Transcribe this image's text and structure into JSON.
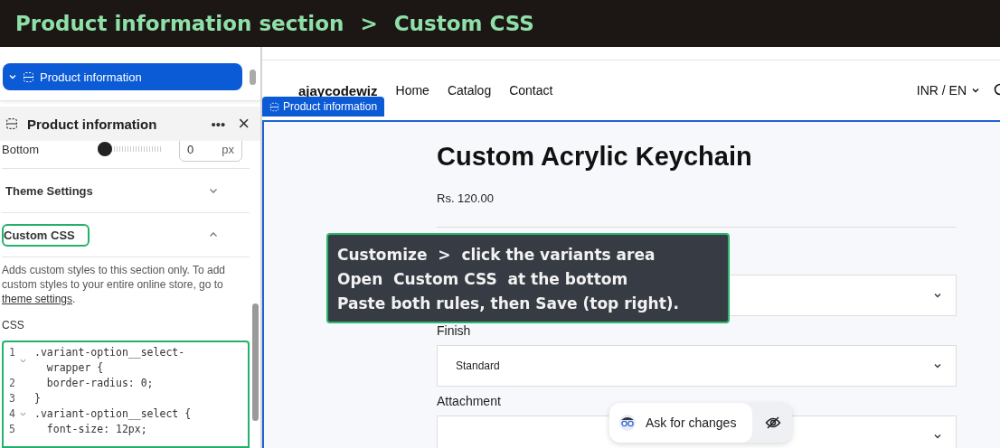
{
  "banner": {
    "title": "Product information section",
    "separator": ">",
    "subtitle": "Custom CSS"
  },
  "sidebar": {
    "tree_item": {
      "label": "Product information",
      "selected": true,
      "expanded": true
    },
    "panel": {
      "title": "Product information",
      "more": "•••",
      "close": "×"
    },
    "bottom_setting": {
      "label": "Bottom",
      "level": 0,
      "value": "0",
      "unit": "px"
    },
    "sections": [
      {
        "label": "Theme Settings",
        "expanded": false,
        "highlighted": false
      },
      {
        "label": "Custom CSS",
        "expanded": true,
        "highlighted": true
      }
    ],
    "description": {
      "text": "Adds custom styles to this section only. To add custom styles to your entire online store, go to ",
      "link": "theme settings",
      "end": "."
    },
    "css_label": "CSS",
    "code_lines": [
      {
        "number": "1",
        "foldable": true,
        "text": ".variant-option__select-\n  wrapper {"
      },
      {
        "number": "2",
        "foldable": false,
        "text": "  border-radius: 0;"
      },
      {
        "number": "3",
        "foldable": false,
        "text": "}"
      },
      {
        "number": "4",
        "foldable": true,
        "text": ".variant-option__select {"
      },
      {
        "number": "5",
        "foldable": false,
        "text": "  font-size: 12px;"
      }
    ]
  },
  "preview": {
    "store_name": "ajaycodewiz",
    "nav": [
      "Home",
      "Catalog",
      "Contact"
    ],
    "locale": "INR / EN",
    "section_badge": "Product information",
    "product": {
      "title": "Custom Acrylic Keychain",
      "price": "Rs. 120.00",
      "options": [
        {
          "kind": "select"
        },
        {
          "kind": "select",
          "label": "Finish",
          "value": "Standard"
        },
        {
          "kind": "select",
          "label": "Attachment"
        }
      ]
    },
    "ask_button": "Ask for changes"
  },
  "annotation": {
    "lines": [
      "Customize  >  click the variants area",
      "Open  Custom CSS  at the bottom",
      "Paste both rules, then Save (top right)."
    ]
  }
}
